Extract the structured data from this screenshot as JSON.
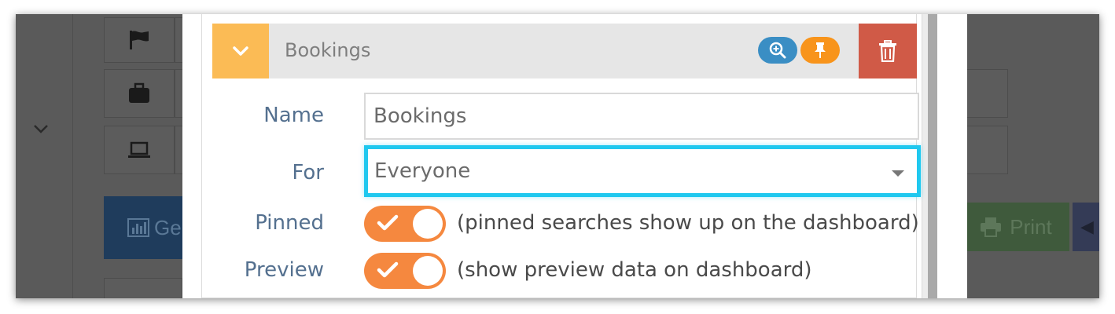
{
  "panel": {
    "title": "Bookings",
    "colors": {
      "collapse": "#fbbb55",
      "zoom": "#3a8ec4",
      "pin": "#f8941b",
      "delete": "#d05a47",
      "focus": "#1fc8ef",
      "toggle": "#f5883f"
    }
  },
  "form": {
    "name_label": "Name",
    "name_value": "Bookings",
    "for_label": "For",
    "for_value": "Everyone",
    "pinned_label": "Pinned",
    "pinned_on": true,
    "pinned_hint": "(pinned searches show up on the dashboard)",
    "preview_label": "Preview",
    "preview_on": true,
    "preview_hint": "(show preview data on dashboard)"
  },
  "background": {
    "generate_text": "Ge",
    "print_text": "Print",
    "icons": [
      "flag-icon",
      "briefcase-icon",
      "laptop-icon",
      "bar-chart-icon",
      "print-icon"
    ]
  }
}
